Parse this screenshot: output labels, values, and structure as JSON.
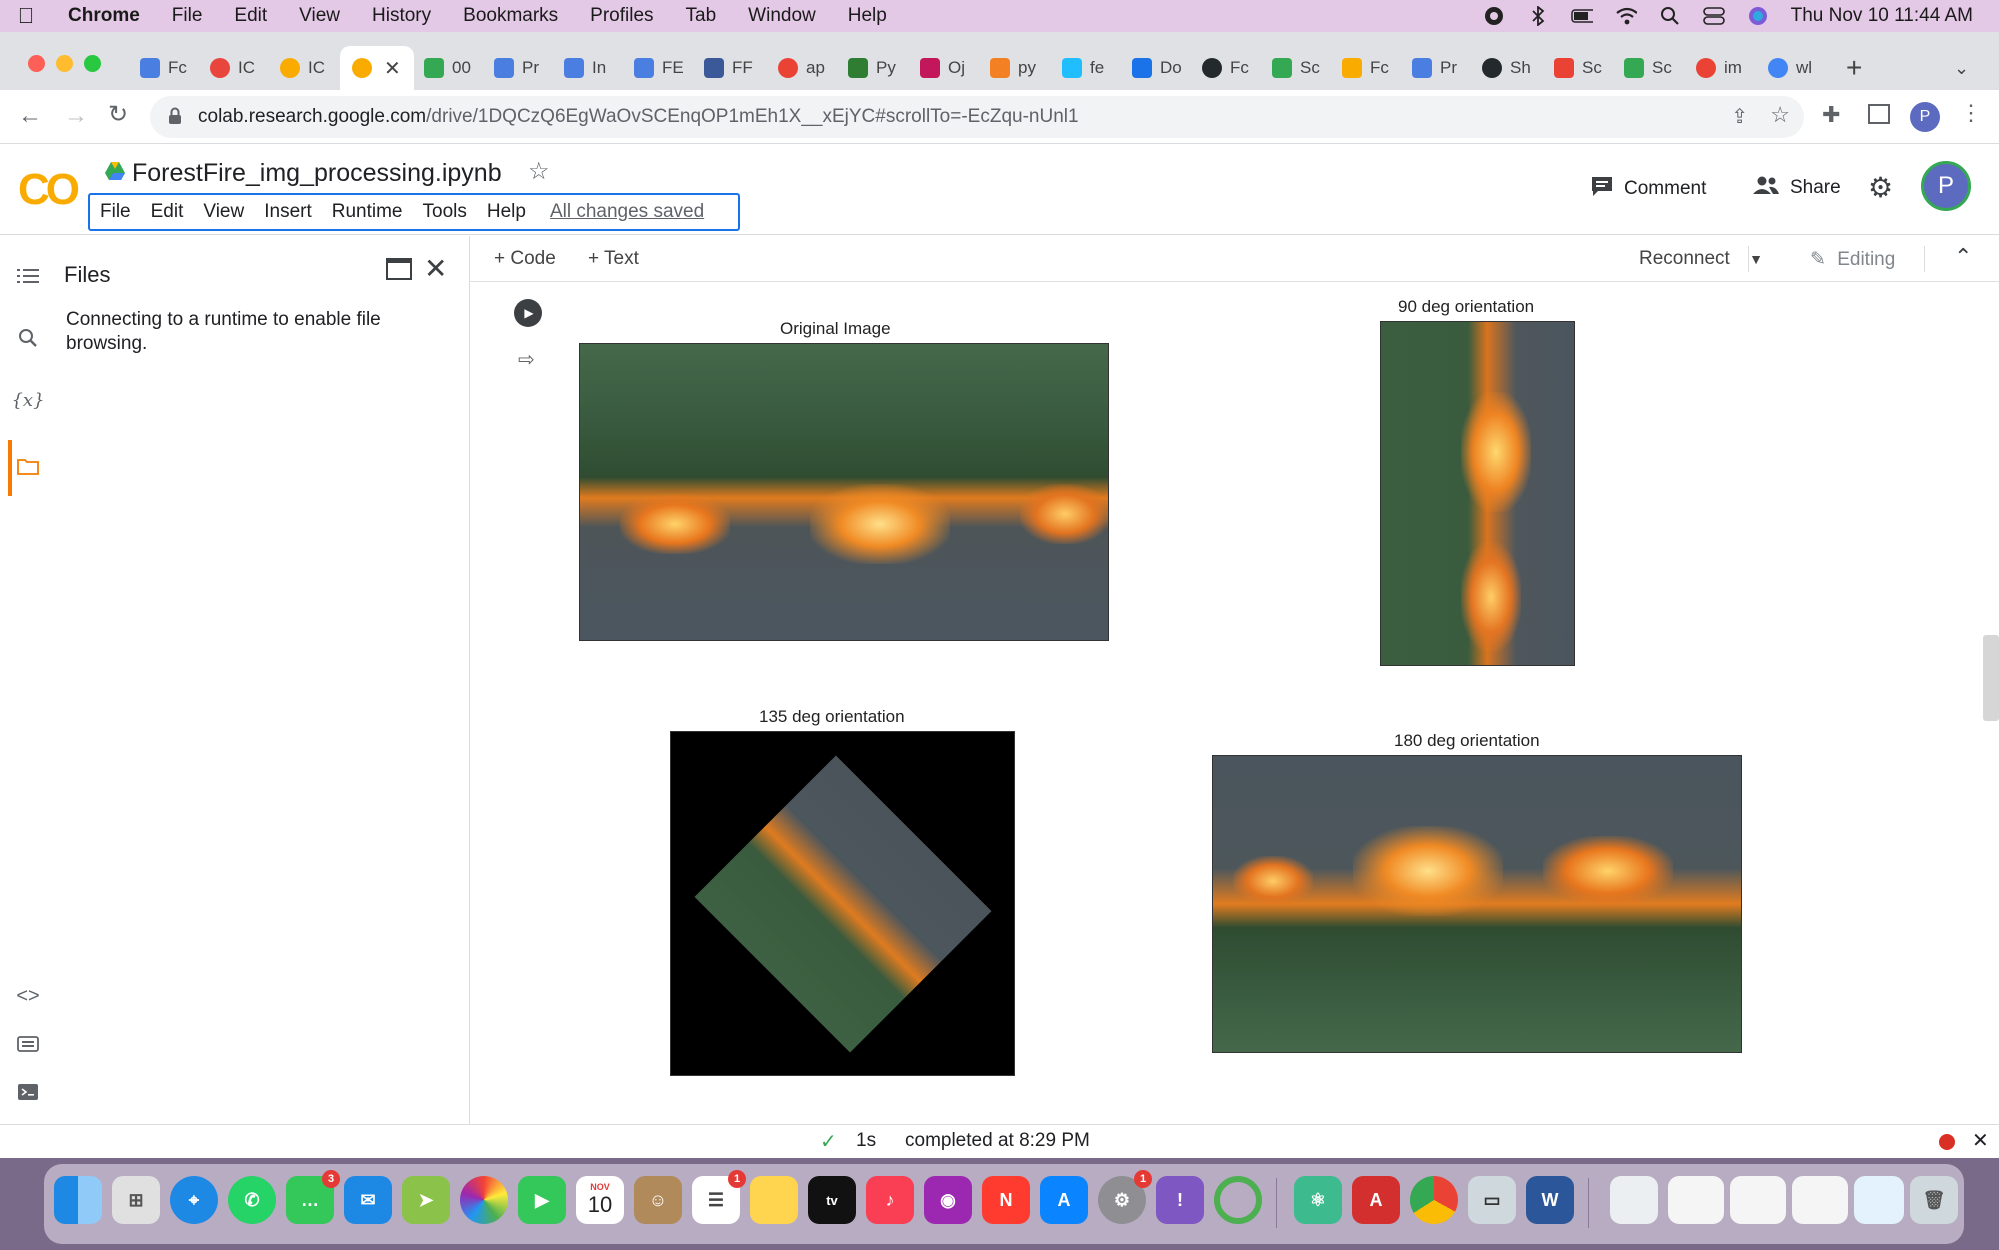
{
  "mac_menubar": {
    "app": "Chrome",
    "menus": [
      "File",
      "Edit",
      "View",
      "History",
      "Bookmarks",
      "Profiles",
      "Tab",
      "Window",
      "Help"
    ],
    "clock": "Thu Nov 10  11:44 AM"
  },
  "browser": {
    "tabs": [
      {
        "label": "Fc"
      },
      {
        "label": "IC"
      },
      {
        "label": "IC"
      },
      {
        "label": ""
      },
      {
        "label": "00"
      },
      {
        "label": "Pr"
      },
      {
        "label": "In"
      },
      {
        "label": "FE"
      },
      {
        "label": "FF"
      },
      {
        "label": "ap"
      },
      {
        "label": "Py"
      },
      {
        "label": "Oj"
      },
      {
        "label": "py"
      },
      {
        "label": "fe"
      },
      {
        "label": "Do"
      },
      {
        "label": "Fc"
      },
      {
        "label": "Sc"
      },
      {
        "label": "Fc"
      },
      {
        "label": "Pr"
      },
      {
        "label": "Sh"
      },
      {
        "label": "Sc"
      },
      {
        "label": "Sc"
      },
      {
        "label": "im"
      },
      {
        "label": "wl"
      }
    ],
    "url_domain": "colab.research.google.com",
    "url_path": "/drive/1DQCzQ6EgWaOvSCEnqOP1mEh1X__xEjYC#scrollTo=-EcZqu-nUnl1",
    "profile_initial": "P"
  },
  "colab": {
    "notebook_title": "ForestFire_img_processing.ipynb",
    "menus": [
      "File",
      "Edit",
      "View",
      "Insert",
      "Runtime",
      "Tools",
      "Help"
    ],
    "save_status": "All changes saved",
    "comment_label": "Comment",
    "share_label": "Share",
    "avatar_initial": "P",
    "toolbar": {
      "add_code": "+ Code",
      "add_text": "+ Text",
      "reconnect": "Reconnect",
      "editing": "Editing"
    },
    "files_panel": {
      "title": "Files",
      "message": "Connecting to a runtime to enable file browsing."
    },
    "rail_icons": [
      "toc-icon",
      "search-icon",
      "variables-icon",
      "folder-icon",
      "code-snippets-icon",
      "command-palette-icon",
      "terminal-icon"
    ],
    "output": {
      "figures": [
        {
          "title": "Original Image"
        },
        {
          "title": "90 deg orientation"
        },
        {
          "title": "135 deg orientation"
        },
        {
          "title": "180 deg orientation"
        }
      ]
    },
    "status": {
      "duration": "1s",
      "completed": "completed at 8:29 PM"
    }
  },
  "dock": {
    "apps": [
      {
        "name": "Finder"
      },
      {
        "name": "Launchpad"
      },
      {
        "name": "Safari"
      },
      {
        "name": "WhatsApp"
      },
      {
        "name": "Messages",
        "badge": "3"
      },
      {
        "name": "Mail"
      },
      {
        "name": "Maps"
      },
      {
        "name": "Photos"
      },
      {
        "name": "FaceTime"
      },
      {
        "name": "Calendar",
        "month": "NOV",
        "day": "10"
      },
      {
        "name": "Contacts"
      },
      {
        "name": "Reminders",
        "badge": "1"
      },
      {
        "name": "Notes"
      },
      {
        "name": "TV"
      },
      {
        "name": "Music"
      },
      {
        "name": "Podcasts"
      },
      {
        "name": "News"
      },
      {
        "name": "App Store"
      },
      {
        "name": "System Preferences",
        "badge": "1"
      },
      {
        "name": "Feedback"
      },
      {
        "name": "Activity"
      },
      {
        "name": "Atom"
      },
      {
        "name": "Acrobat"
      },
      {
        "name": "Chrome"
      },
      {
        "name": "Preview"
      },
      {
        "name": "Word"
      }
    ]
  }
}
